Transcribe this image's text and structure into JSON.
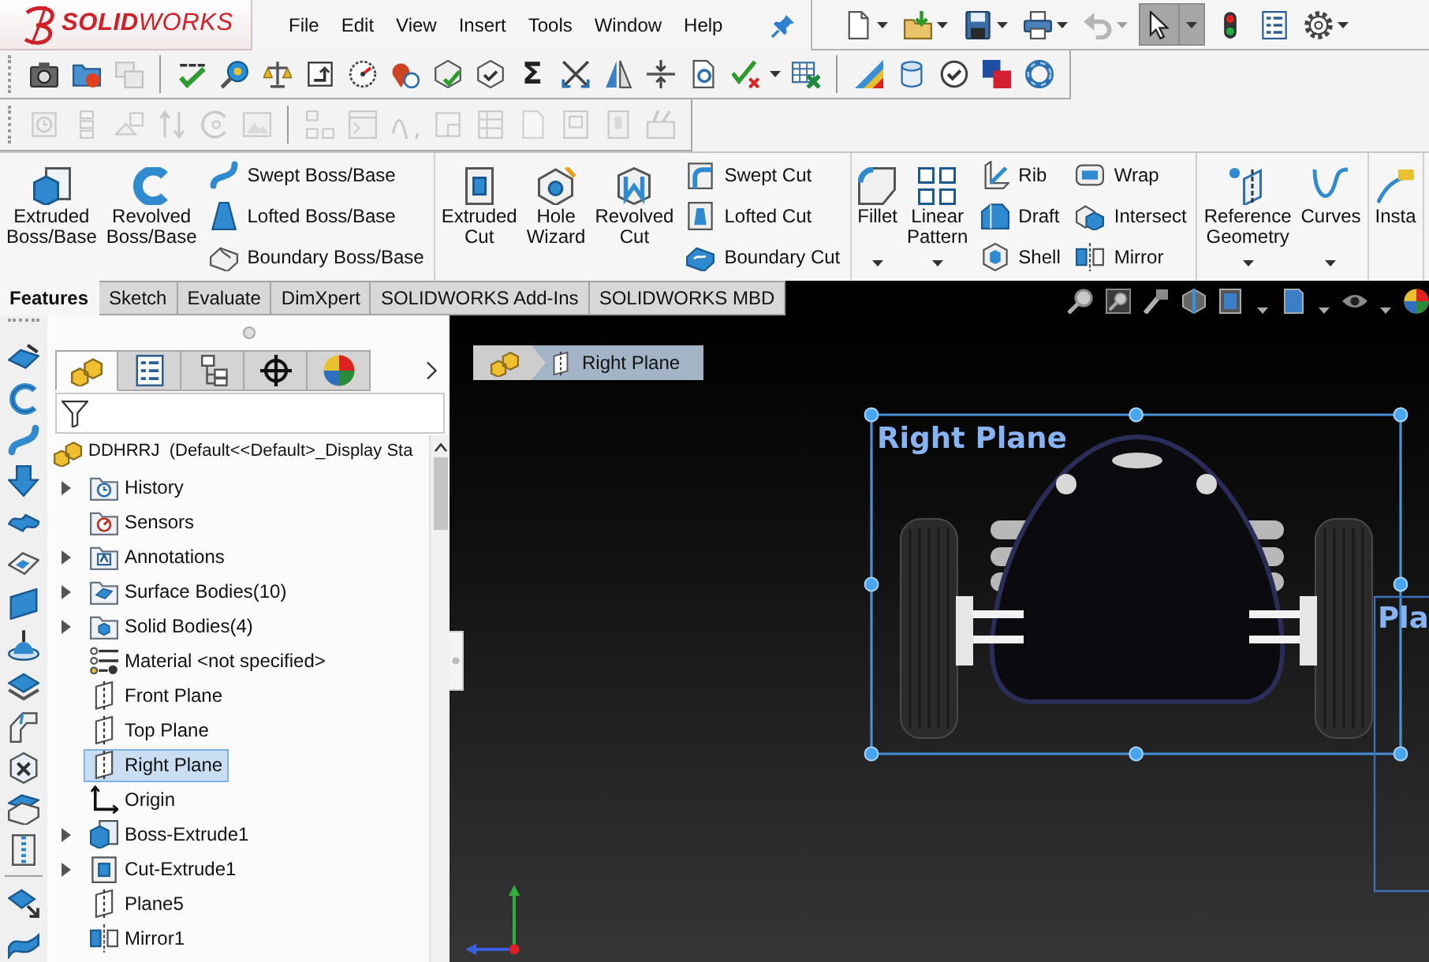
{
  "app": {
    "logo": "**SOLID**WORKS",
    "menu": [
      "File",
      "Edit",
      "View",
      "Insert",
      "Tools",
      "Window",
      "Help"
    ]
  },
  "quick_access": [
    {
      "kind": "new",
      "dropdown": true,
      "disabled": false,
      "pressed": false
    },
    {
      "kind": "open",
      "dropdown": true,
      "disabled": false,
      "pressed": false
    },
    {
      "kind": "save",
      "dropdown": true,
      "disabled": false,
      "pressed": false
    },
    {
      "kind": "print",
      "dropdown": true,
      "disabled": false,
      "pressed": false
    },
    {
      "kind": "undo",
      "dropdown": true,
      "disabled": true,
      "pressed": false
    },
    {
      "kind": "select",
      "dropdown": true,
      "disabled": false,
      "pressed": true
    },
    {
      "kind": "rebuild",
      "dropdown": false,
      "disabled": false,
      "pressed": false
    },
    {
      "kind": "file-properties",
      "dropdown": false,
      "disabled": false,
      "pressed": false
    },
    {
      "kind": "options",
      "dropdown": true,
      "disabled": false,
      "pressed": false
    }
  ],
  "toolbars": [
    {
      "items": [
        {
          "kind": "camera",
          "disabled": false
        },
        {
          "kind": "record",
          "disabled": false
        },
        {
          "kind": "windows",
          "disabled": true
        },
        {
          "kind": "separator"
        },
        {
          "kind": "spell-check",
          "disabled": false
        },
        {
          "kind": "measure",
          "disabled": false
        },
        {
          "kind": "mass",
          "disabled": false
        },
        {
          "kind": "section-properties",
          "disabled": false
        },
        {
          "kind": "sensor",
          "disabled": false
        },
        {
          "kind": "pin",
          "disabled": false
        },
        {
          "kind": "check-cube",
          "disabled": false
        },
        {
          "kind": "check-box",
          "disabled": false
        },
        {
          "kind": "glyph",
          "text": "Σ",
          "disabled": false
        },
        {
          "kind": "crossing",
          "disabled": false
        },
        {
          "kind": "wedge",
          "disabled": false
        },
        {
          "kind": "compress",
          "disabled": false
        },
        {
          "kind": "doc-search",
          "disabled": false
        },
        {
          "kind": "check-cross",
          "disabled": false,
          "dropdown": true
        },
        {
          "kind": "spreadsheet",
          "disabled": false
        },
        {
          "kind": "separator"
        },
        {
          "kind": "color-fan",
          "disabled": false
        },
        {
          "kind": "cylinder",
          "disabled": false
        },
        {
          "kind": "circle-check",
          "disabled": false
        },
        {
          "kind": "tiles",
          "disabled": false
        },
        {
          "kind": "ring",
          "disabled": false
        }
      ]
    },
    {
      "items": [
        {
          "kind": "clock",
          "disabled": true
        },
        {
          "kind": "stack",
          "disabled": true
        },
        {
          "kind": "shapes",
          "disabled": true
        },
        {
          "kind": "swap",
          "disabled": true
        },
        {
          "kind": "arc",
          "disabled": true
        },
        {
          "kind": "picture",
          "disabled": true
        },
        {
          "kind": "separator"
        },
        {
          "kind": "blocks",
          "disabled": true
        },
        {
          "kind": "window",
          "disabled": true
        },
        {
          "kind": "wave",
          "disabled": true
        },
        {
          "kind": "page-corner",
          "disabled": true
        },
        {
          "kind": "table",
          "disabled": true
        },
        {
          "kind": "blank-page",
          "disabled": true
        },
        {
          "kind": "doc-frame",
          "disabled": true
        },
        {
          "kind": "book",
          "disabled": true
        },
        {
          "kind": "folder-tools",
          "disabled": true
        }
      ]
    }
  ],
  "ribbon": {
    "groups": [
      {
        "large": [
          {
            "kind": "extruded-boss",
            "label": "Extruded\nBoss/Base",
            "dropdown": false
          },
          {
            "kind": "revolved-boss",
            "label": "Revolved\nBoss/Base",
            "dropdown": false
          }
        ],
        "columns": [
          [
            {
              "kind": "swept-boss",
              "label": "Swept Boss/Base"
            },
            {
              "kind": "lofted-boss",
              "label": "Lofted Boss/Base"
            },
            {
              "kind": "boundary-boss",
              "label": "Boundary Boss/Base"
            }
          ]
        ]
      },
      {
        "large": [
          {
            "kind": "extruded-cut",
            "label": "Extruded\nCut",
            "dropdown": false
          },
          {
            "kind": "hole-wizard",
            "label": "Hole\nWizard",
            "dropdown": false
          },
          {
            "kind": "revolved-cut",
            "label": "Revolved\nCut",
            "dropdown": false
          }
        ],
        "columns": [
          [
            {
              "kind": "swept-cut",
              "label": "Swept Cut"
            },
            {
              "kind": "lofted-cut",
              "label": "Lofted Cut"
            },
            {
              "kind": "boundary-cut",
              "label": "Boundary Cut"
            }
          ]
        ]
      },
      {
        "large": [
          {
            "kind": "fillet",
            "label": "Fillet",
            "dropdown": true
          },
          {
            "kind": "linear-pattern",
            "label": "Linear\nPattern",
            "dropdown": true
          }
        ],
        "columns": [
          [
            {
              "kind": "rib",
              "label": "Rib"
            },
            {
              "kind": "draft",
              "label": "Draft"
            },
            {
              "kind": "shell",
              "label": "Shell"
            }
          ],
          [
            {
              "kind": "wrap",
              "label": "Wrap"
            },
            {
              "kind": "intersect",
              "label": "Intersect"
            },
            {
              "kind": "mirror",
              "label": "Mirror"
            }
          ]
        ]
      },
      {
        "large": [
          {
            "kind": "reference-geometry",
            "label": "Reference\nGeometry",
            "dropdown": true
          },
          {
            "kind": "curves",
            "label": "Curves",
            "dropdown": true
          }
        ]
      },
      {
        "large": [
          {
            "kind": "instant3d",
            "label": "Insta",
            "dropdown": false
          }
        ]
      }
    ]
  },
  "command_tabs": [
    {
      "label": "Features",
      "selected": true
    },
    {
      "label": "Sketch",
      "selected": false
    },
    {
      "label": "Evaluate",
      "selected": false
    },
    {
      "label": "DimXpert",
      "selected": false
    },
    {
      "label": "SOLIDWORKS Add-Ins",
      "selected": false
    },
    {
      "label": "SOLIDWORKS MBD",
      "selected": false
    }
  ],
  "heads_up_toolbar": [
    {
      "kind": "zoom-fit",
      "dropdown": false
    },
    {
      "kind": "zoom-area",
      "dropdown": false
    },
    {
      "kind": "previous-view",
      "dropdown": false
    },
    {
      "kind": "section-view",
      "dropdown": false
    },
    {
      "kind": "view-orientation",
      "dropdown": true
    },
    {
      "kind": "display-style",
      "dropdown": true
    },
    {
      "kind": "hide-show",
      "dropdown": true
    },
    {
      "kind": "appearance",
      "dropdown": false
    }
  ],
  "left_toolbar": [
    {
      "kind": "surface-arrow"
    },
    {
      "kind": "revolve-surface"
    },
    {
      "kind": "s-curve"
    },
    {
      "kind": "down-arrow"
    },
    {
      "kind": "wavy-surface"
    },
    {
      "kind": "surface-patch"
    },
    {
      "kind": "flat-sheet"
    },
    {
      "kind": "dome"
    },
    {
      "kind": "offset-surface"
    },
    {
      "kind": "bent-strip"
    },
    {
      "kind": "box-cross"
    },
    {
      "kind": "stacked-sheets"
    },
    {
      "kind": "zipper"
    },
    {
      "kind": "separator"
    },
    {
      "kind": "surface-extend"
    },
    {
      "kind": "twisted-surface"
    }
  ],
  "feature_manager": {
    "tabs": [
      {
        "kind": "feature-tree",
        "selected": true
      },
      {
        "kind": "property-manager",
        "selected": false
      },
      {
        "kind": "configuration-manager",
        "selected": false
      },
      {
        "kind": "dimxpert-manager",
        "selected": false
      },
      {
        "kind": "display-manager",
        "selected": false
      }
    ],
    "tree": {
      "label": "DDHRRJ  (Default<<Default>_Display Sta",
      "kind": "part",
      "selected": false,
      "children": [
        {
          "label": "History",
          "kind": "history",
          "expandable": true,
          "selected": false
        },
        {
          "label": "Sensors",
          "kind": "sensors",
          "expandable": false,
          "selected": false
        },
        {
          "label": "Annotations",
          "kind": "annotations",
          "expandable": true,
          "selected": false
        },
        {
          "label": "Surface Bodies(10)",
          "kind": "surface-bodies",
          "expandable": true,
          "selected": false
        },
        {
          "label": "Solid Bodies(4)",
          "kind": "solid-bodies",
          "expandable": true,
          "selected": false
        },
        {
          "label": "Material <not specified>",
          "kind": "material",
          "expandable": false,
          "selected": false
        },
        {
          "label": "Front Plane",
          "kind": "plane",
          "expandable": false,
          "selected": false
        },
        {
          "label": "Top Plane",
          "kind": "plane",
          "expandable": false,
          "selected": false
        },
        {
          "label": "Right Plane",
          "kind": "plane",
          "expandable": false,
          "selected": true
        },
        {
          "label": "Origin",
          "kind": "origin",
          "expandable": false,
          "selected": false
        },
        {
          "label": "Boss-Extrude1",
          "kind": "boss-extrude",
          "expandable": true,
          "selected": false
        },
        {
          "label": "Cut-Extrude1",
          "kind": "cut-extrude",
          "expandable": true,
          "selected": false
        },
        {
          "label": "Plane5",
          "kind": "plane",
          "expandable": false,
          "selected": false
        },
        {
          "label": "Mirror1",
          "kind": "mirror",
          "expandable": false,
          "selected": false
        }
      ]
    }
  },
  "viewport": {
    "breadcrumb": [
      {
        "kind": "part"
      },
      {
        "kind": "plane",
        "label": "Right Plane"
      }
    ],
    "planes": [
      {
        "label": "Right Plane",
        "selected": true
      },
      {
        "label": "Pla",
        "selected": false
      }
    ]
  }
}
